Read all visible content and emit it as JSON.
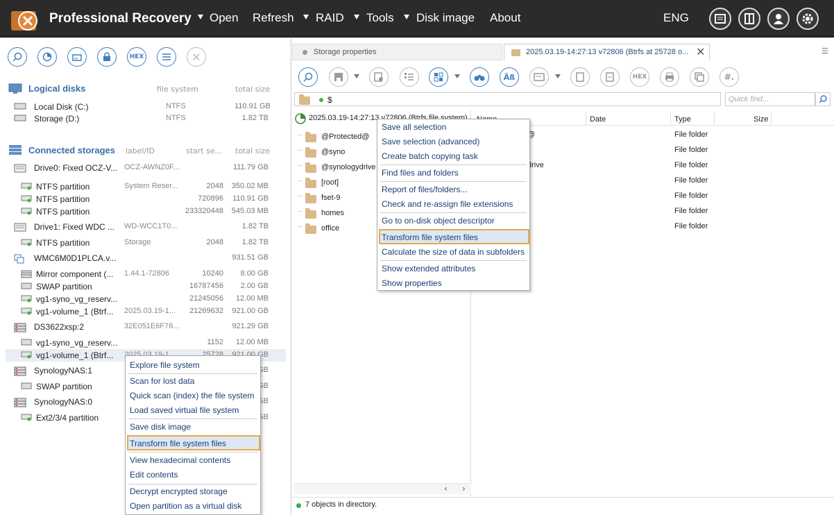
{
  "app": {
    "title": "Professional Recovery"
  },
  "menu": {
    "open": "Open",
    "refresh": "Refresh",
    "raid": "RAID",
    "tools": "Tools",
    "disk_image": "Disk image",
    "about": "About",
    "lang": "ENG"
  },
  "left": {
    "logical_header": {
      "title": "Logical disks",
      "col_fs": "file system",
      "col_size": "total size"
    },
    "logical": [
      {
        "name": "Local Disk (C:)",
        "fs": "NTFS",
        "size": "110.91 GB"
      },
      {
        "name": "Storage (D:)",
        "fs": "NTFS",
        "size": "1.82 TB"
      }
    ],
    "storage_header": {
      "title": "Connected storages",
      "col_label": "label/ID",
      "col_start": "start se...",
      "col_size": "total size"
    },
    "storages": [
      {
        "name": "Drive0: Fixed OCZ-V...",
        "label": "OCZ-AWNZ0F...",
        "start": "",
        "size": "111.79 GB"
      },
      {
        "name": "NTFS partition",
        "label": "System Reser...",
        "start": "2048",
        "size": "350.02 MB"
      },
      {
        "name": "NTFS partition",
        "label": "",
        "start": "720896",
        "size": "110.91 GB"
      },
      {
        "name": "NTFS partition",
        "label": "",
        "start": "233320448",
        "size": "545.03 MB"
      },
      {
        "name": "Drive1: Fixed WDC ...",
        "label": "WD-WCC1T0...",
        "start": "",
        "size": "1.82 TB"
      },
      {
        "name": "NTFS partition",
        "label": "Storage",
        "start": "2048",
        "size": "1.82 TB"
      },
      {
        "name": "WMC6M0D1PLCA.v...",
        "label": "",
        "start": "",
        "size": "931.51 GB"
      },
      {
        "name": "Mirror component (...",
        "label": "1.44.1-72806",
        "start": "10240",
        "size": "8.00 GB"
      },
      {
        "name": "SWAP partition",
        "label": "",
        "start": "16787456",
        "size": "2.00 GB"
      },
      {
        "name": "vg1-syno_vg_reserv...",
        "label": "",
        "start": "21245056",
        "size": "12.00 MB"
      },
      {
        "name": "vg1-volume_1 (Btrf...",
        "label": "2025.03.19-1...",
        "start": "21269632",
        "size": "921.00 GB"
      },
      {
        "name": "DS3622xsp:2",
        "label": "32E051E6F76...",
        "start": "",
        "size": "921.29 GB"
      },
      {
        "name": "vg1-syno_vg_reserv...",
        "label": "",
        "start": "1152",
        "size": "12.00 MB"
      },
      {
        "name": "vg1-volume_1 (Btrf...",
        "label": "2025.03.19-1...",
        "start": "25728",
        "size": "921.00 GB"
      },
      {
        "name": "SynologyNAS:1",
        "label": "",
        "start": "",
        "size": "GB"
      },
      {
        "name": "SWAP partition",
        "label": "",
        "start": "",
        "size": "GB"
      },
      {
        "name": "SynologyNAS:0",
        "label": "",
        "start": "",
        "size": "GB"
      },
      {
        "name": "Ext2/3/4 partition",
        "label": "",
        "start": "",
        "size": "GB"
      }
    ]
  },
  "left_menu": [
    "Explore file system",
    "Scan for lost data",
    "Quick scan (index) the file system",
    "Load saved virtual file system",
    "Save disk image",
    "Transform file system files",
    "View hexadecimal contents",
    "Edit contents",
    "Decrypt encrypted storage",
    "Open partition as a virtual disk"
  ],
  "tabs": {
    "t1": "Storage properties",
    "t2": "2025.03.19-14:27:13 v72806 (Btrfs at 25728 o..."
  },
  "path": {
    "value": "$",
    "quick_find": "Quick find..."
  },
  "tree": {
    "root": "2025.03.19-14:27:13 v72806 (Btrfs file system)",
    "items": [
      "@Protected@",
      "@syno",
      "@synologydrive",
      "[root]",
      "fset-9",
      "homes",
      "office"
    ]
  },
  "list": {
    "cols": {
      "name": "Name",
      "date": "Date",
      "type": "Type",
      "size": "Size"
    },
    "rows": [
      {
        "name": "@Protected@",
        "type": "File folder"
      },
      {
        "name": "@syno",
        "type": "File folder"
      },
      {
        "name": "@synologydrive",
        "type": "File folder"
      },
      {
        "name": "[root]",
        "type": "File folder"
      },
      {
        "name": "fset-9",
        "type": "File folder"
      },
      {
        "name": "homes",
        "type": "File folder"
      },
      {
        "name": "office",
        "type": "File folder"
      }
    ],
    "visible_name_fragments": [
      "@",
      "drive"
    ]
  },
  "right_menu": [
    "Save all selection",
    "Save selection (advanced)",
    "Create batch copying task",
    "Find files and folders",
    "Report of files/folders...",
    "Check and re-assign file extensions",
    "Go to on-disk object descriptor",
    "Transform file system files",
    "Calculate the size of data in subfolders",
    "Show extended attributes",
    "Show properties"
  ],
  "status": {
    "text": "7 objects in directory."
  },
  "colors": {
    "topbar": "#2b2b2b",
    "accent": "#3d7ec0",
    "highlight_border": "#e8a84a"
  }
}
